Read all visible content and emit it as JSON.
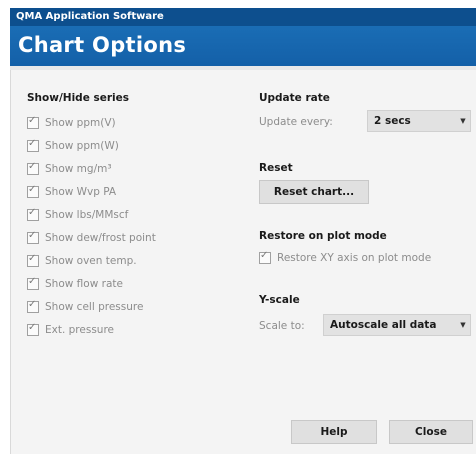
{
  "window": {
    "title": "QMA Application Software"
  },
  "header": {
    "title": "Chart Options"
  },
  "series": {
    "heading": "Show/Hide series",
    "items": [
      {
        "label": "Show ppm(V)",
        "checked": true
      },
      {
        "label": "Show ppm(W)",
        "checked": true
      },
      {
        "label": "Show mg/m³",
        "checked": true
      },
      {
        "label": "Show Wvp PA",
        "checked": true
      },
      {
        "label": "Show lbs/MMscf",
        "checked": true
      },
      {
        "label": "Show dew/frost point",
        "checked": true
      },
      {
        "label": "Show oven temp.",
        "checked": true
      },
      {
        "label": "Show flow rate",
        "checked": true
      },
      {
        "label": "Show cell pressure",
        "checked": true
      },
      {
        "label": "Ext. pressure",
        "checked": true
      }
    ]
  },
  "update_rate": {
    "heading": "Update rate",
    "label": "Update every:",
    "value": "2 secs"
  },
  "reset": {
    "heading": "Reset",
    "button_label": "Reset chart..."
  },
  "restore": {
    "heading": "Restore on plot mode",
    "checkbox_label": "Restore XY axis on plot mode",
    "checked": true
  },
  "yscale": {
    "heading": "Y-scale",
    "label": "Scale to:",
    "value": "Autoscale all data"
  },
  "footer": {
    "help_label": "Help",
    "close_label": "Close"
  },
  "colors": {
    "titlebar": "#0d4f8e",
    "header": "#1a6db5",
    "panel": "#f4f4f4",
    "disabled_text": "#8c8c8c"
  }
}
